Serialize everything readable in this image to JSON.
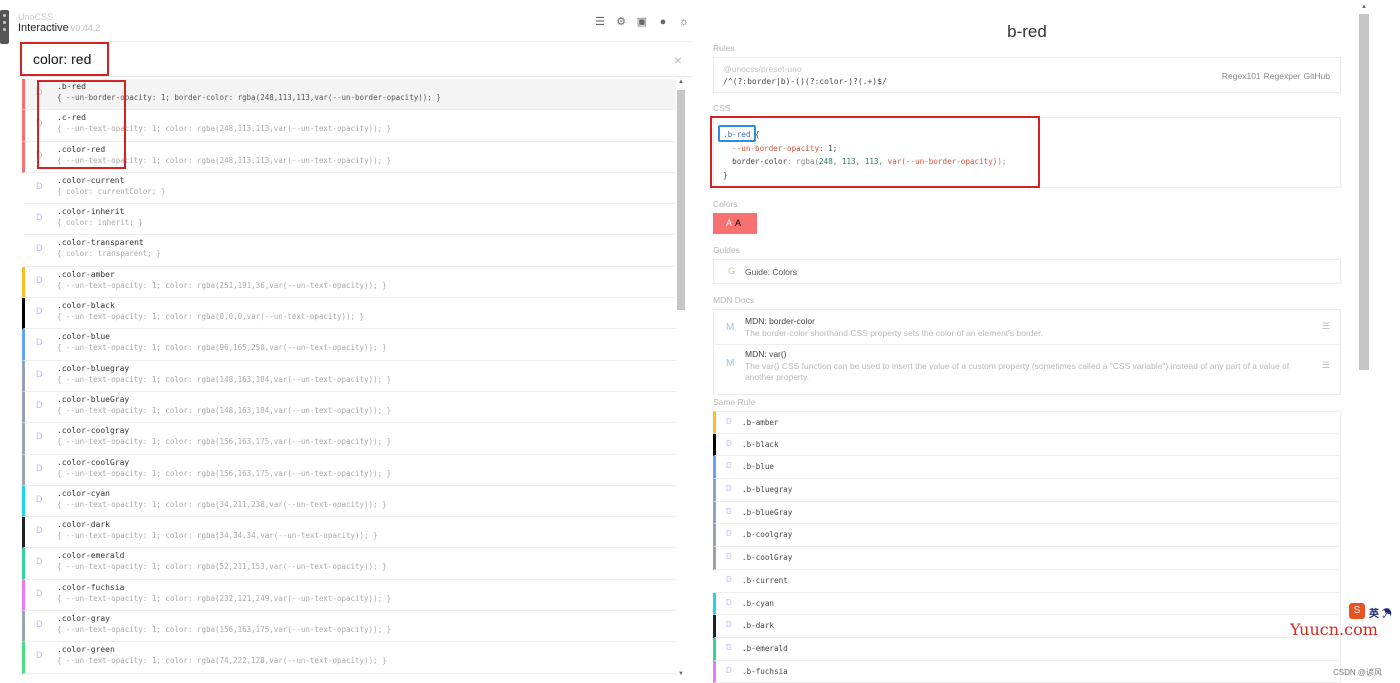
{
  "brand": {
    "small": "UnoCSS",
    "title": "Interactive",
    "version": "v0.44.2"
  },
  "toolbar_icons": [
    "list-icon",
    "settings-icon",
    "layout-icon",
    "github-icon",
    "sun-icon"
  ],
  "search": {
    "value": "color: red",
    "clear": "×"
  },
  "results": [
    {
      "name": ".b-red",
      "rule": "{ --un-border-opacity: 1; border-color: rgba(248,113,113,var(--un-border-opacity)); }",
      "color": "#f87171",
      "active": true
    },
    {
      "name": ".c-red",
      "rule": "{ --un-text-opacity: 1; color: rgba(248,113,113,var(--un-text-opacity)); }",
      "color": "#f87171"
    },
    {
      "name": ".color-red",
      "rule": "{ --un-text-opacity: 1; color: rgba(248,113,113,var(--un-text-opacity)); }",
      "color": "#f87171"
    },
    {
      "name": ".color-current",
      "rule": "{ color: currentColor; }",
      "color": ""
    },
    {
      "name": ".color-inherit",
      "rule": "{ color: inherit; }",
      "color": ""
    },
    {
      "name": ".color-transparent",
      "rule": "{ color: transparent; }",
      "color": ""
    },
    {
      "name": ".color-amber",
      "rule": "{ --un-text-opacity: 1; color: rgba(251,191,36,var(--un-text-opacity)); }",
      "color": "#fbbf24"
    },
    {
      "name": ".color-black",
      "rule": "{ --un-text-opacity: 1; color: rgba(0,0,0,var(--un-text-opacity)); }",
      "color": "#000000"
    },
    {
      "name": ".color-blue",
      "rule": "{ --un-text-opacity: 1; color: rgba(96,165,250,var(--un-text-opacity)); }",
      "color": "#60a5fa"
    },
    {
      "name": ".color-bluegray",
      "rule": "{ --un-text-opacity: 1; color: rgba(148,163,184,var(--un-text-opacity)); }",
      "color": "#94a3b8"
    },
    {
      "name": ".color-blueGray",
      "rule": "{ --un-text-opacity: 1; color: rgba(148,163,184,var(--un-text-opacity)); }",
      "color": "#94a3b8"
    },
    {
      "name": ".color-coolgray",
      "rule": "{ --un-text-opacity: 1; color: rgba(156,163,175,var(--un-text-opacity)); }",
      "color": "#9ca3af"
    },
    {
      "name": ".color-coolGray",
      "rule": "{ --un-text-opacity: 1; color: rgba(156,163,175,var(--un-text-opacity)); }",
      "color": "#9ca3af"
    },
    {
      "name": ".color-cyan",
      "rule": "{ --un-text-opacity: 1; color: rgba(34,211,238,var(--un-text-opacity)); }",
      "color": "#22d3ee"
    },
    {
      "name": ".color-dark",
      "rule": "{ --un-text-opacity: 1; color: rgba(34,34,34,var(--un-text-opacity)); }",
      "color": "#222222"
    },
    {
      "name": ".color-emerald",
      "rule": "{ --un-text-opacity: 1; color: rgba(52,211,153,var(--un-text-opacity)); }",
      "color": "#34d399"
    },
    {
      "name": ".color-fuchsia",
      "rule": "{ --un-text-opacity: 1; color: rgba(232,121,249,var(--un-text-opacity)); }",
      "color": "#e879f9"
    },
    {
      "name": ".color-gray",
      "rule": "{ --un-text-opacity: 1; color: rgba(156,163,175,var(--un-text-opacity)); }",
      "color": "#9ca3af"
    },
    {
      "name": ".color-green",
      "rule": "{ --un-text-opacity: 1; color: rgba(74,222,128,var(--un-text-opacity)); }",
      "color": "#4ade80"
    }
  ],
  "detail": {
    "title": "b-red",
    "rules_label": "Rules",
    "rules_source": "@unocss/preset-uno",
    "rules_regex": "/^(?:border|b)-()(?:color-)?(.+)$/",
    "rules_links": [
      "Regex101",
      "Regexper",
      "GitHub"
    ],
    "css_label": "CSS",
    "css_selector": ".b-red",
    "css_open": " {",
    "css_line1_prop": "--un-border-opacity",
    "css_line1_val": ": 1;",
    "css_line2_prop": "border-color",
    "css_line2_pre": ": rgba(",
    "css_line2_nums": "248, 113, 113,",
    "css_line2_var": " var(--un-border-opacity)",
    "css_line2_end": ");",
    "css_close": "}",
    "colors_label": "Colors",
    "color_chip": {
      "a_white": "A",
      "a_black": "A",
      "color": "#f87171"
    },
    "guides_label": "Guides",
    "guide": {
      "icon": "G",
      "text": "Guide: Colors"
    },
    "mdn_label": "MDN Docs",
    "mdn": [
      {
        "icon": "M",
        "title": "MDN: border-color",
        "desc": "The border-color shorthand CSS property sets the color of an element's border."
      },
      {
        "icon": "M",
        "title": "MDN: var()",
        "desc": "The var() CSS function can be used to insert the value of a custom property (sometimes called a \"CSS variable\") instead of any part of a value of another property."
      }
    ],
    "same_rule_label": "Same Rule",
    "same_rule": [
      {
        "name": ".b-amber",
        "color": "#fbbf24"
      },
      {
        "name": ".b-black",
        "color": "#000000"
      },
      {
        "name": ".b-blue",
        "color": "#60a5fa"
      },
      {
        "name": ".b-bluegray",
        "color": "#94a3b8"
      },
      {
        "name": ".b-blueGray",
        "color": "#94a3b8"
      },
      {
        "name": ".b-coolgray",
        "color": "#9ca3af"
      },
      {
        "name": ".b-coolGray",
        "color": "#9ca3af"
      },
      {
        "name": ".b-current",
        "color": ""
      },
      {
        "name": ".b-cyan",
        "color": "#22d3ee"
      },
      {
        "name": ".b-dark",
        "color": "#222222"
      },
      {
        "name": ".b-emerald",
        "color": "#34d399"
      },
      {
        "name": ".b-fuchsia",
        "color": "#e879f9"
      }
    ]
  },
  "watermark": {
    "text": "Yuucn.com",
    "icon_letter": "S",
    "icon_text": "英 ☂",
    "csdn": "CSDN @谚风"
  }
}
